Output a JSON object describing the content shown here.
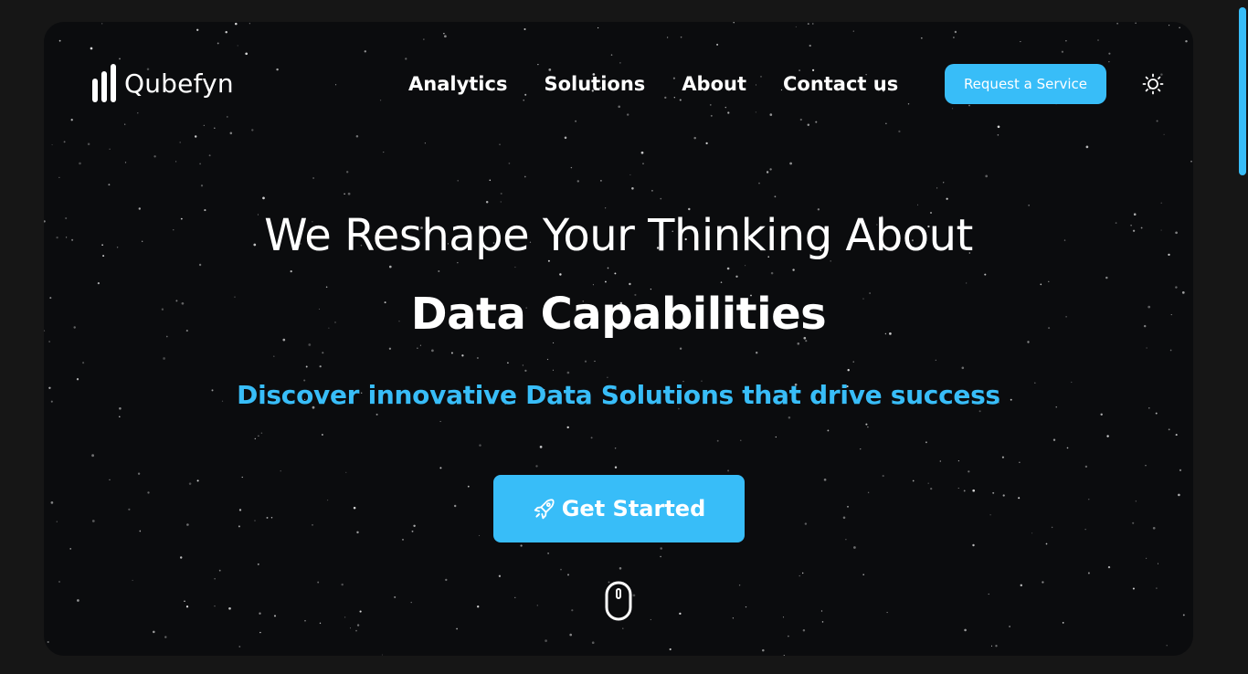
{
  "brand": {
    "name": "Qubefyn",
    "logo_icon": "bars-logo-icon"
  },
  "nav": {
    "items": [
      {
        "label": "Analytics"
      },
      {
        "label": "Solutions"
      },
      {
        "label": "About"
      },
      {
        "label": "Contact us"
      }
    ]
  },
  "header": {
    "request_label": "Request a Service",
    "theme_icon": "sun-icon"
  },
  "hero": {
    "headline": "We Reshape Your Thinking About",
    "headline_strong": "Data Capabilities",
    "subheadline": "Discover innovative Data Solutions that drive success",
    "cta_label": "Get Started",
    "cta_icon": "rocket-icon",
    "scroll_icon": "mouse-icon"
  },
  "colors": {
    "accent": "#38bdf8",
    "page_bg": "#161616",
    "hero_bg": "#0b0c0e",
    "text": "#ffffff"
  }
}
